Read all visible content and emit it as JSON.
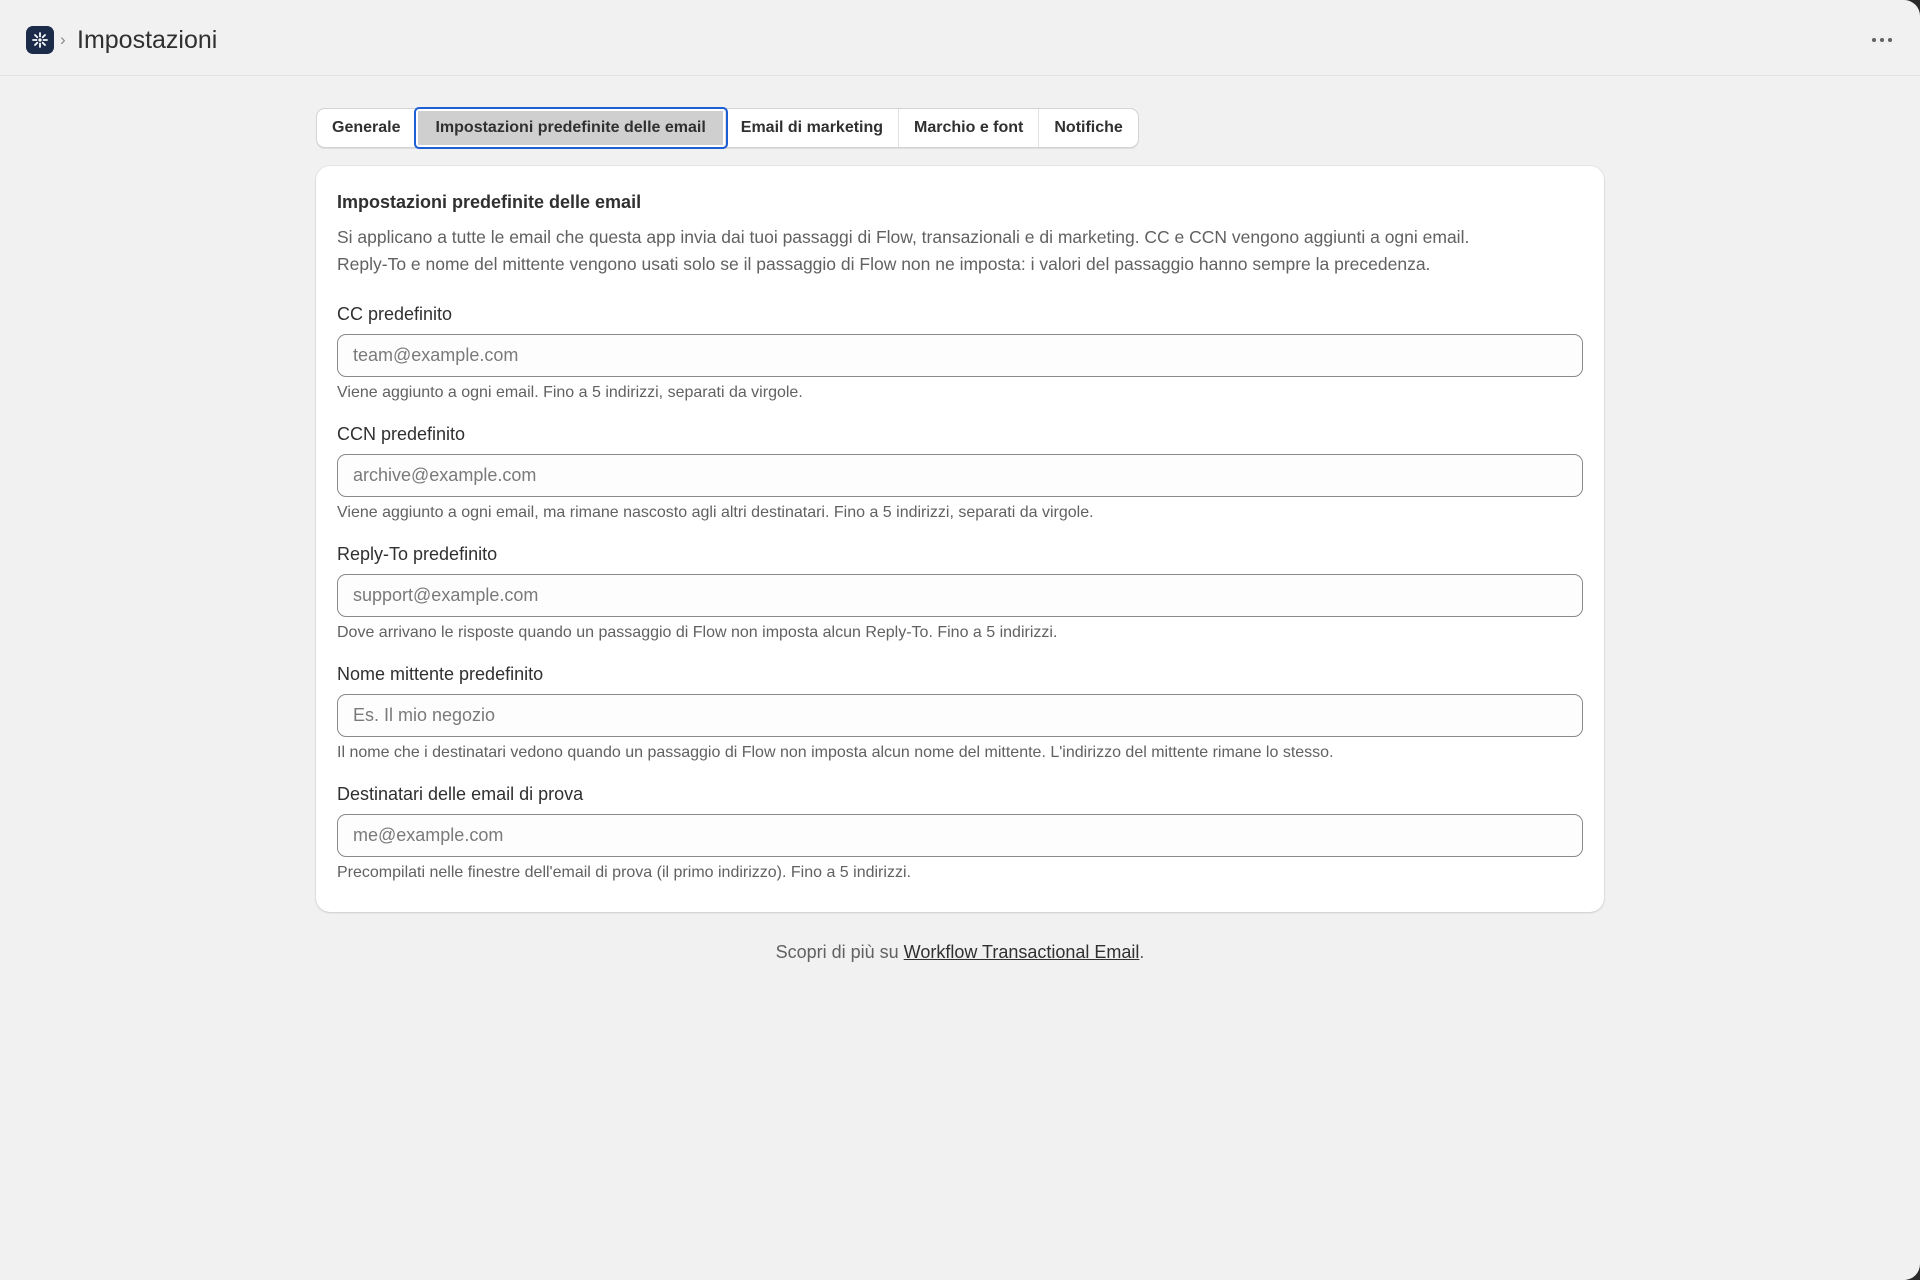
{
  "header": {
    "breadcrumb_separator": "›",
    "title": "Impostazioni",
    "more_label": "⋯"
  },
  "tabs": [
    {
      "label": "Generale",
      "active": false
    },
    {
      "label": "Impostazioni predefinite delle email",
      "active": true
    },
    {
      "label": "Email di marketing",
      "active": false
    },
    {
      "label": "Marchio e font",
      "active": false
    },
    {
      "label": "Notifiche",
      "active": false
    }
  ],
  "card": {
    "title": "Impostazioni predefinite delle email",
    "description_line1": "Si applicano a tutte le email che questa app invia dai tuoi passaggi di Flow, transazionali e di marketing. CC e CCN vengono aggiunti a ogni email.",
    "description_line2": "Reply-To e nome del mittente vengono usati solo se il passaggio di Flow non ne imposta: i valori del passaggio hanno sempre la precedenza.",
    "fields": [
      {
        "label": "CC predefinito",
        "value": "",
        "placeholder": "team@example.com",
        "help": "Viene aggiunto a ogni email. Fino a 5 indirizzi, separati da virgole."
      },
      {
        "label": "CCN predefinito",
        "value": "",
        "placeholder": "archive@example.com",
        "help": "Viene aggiunto a ogni email, ma rimane nascosto agli altri destinatari. Fino a 5 indirizzi, separati da virgole."
      },
      {
        "label": "Reply-To predefinito",
        "value": "",
        "placeholder": "support@example.com",
        "help": "Dove arrivano le risposte quando un passaggio di Flow non imposta alcun Reply-To. Fino a 5 indirizzi."
      },
      {
        "label": "Nome mittente predefinito",
        "value": "",
        "placeholder": "Es. Il mio negozio",
        "help": "Il nome che i destinatari vedono quando un passaggio di Flow non imposta alcun nome del mittente. L'indirizzo del mittente rimane lo stesso."
      },
      {
        "label": "Destinatari delle email di prova",
        "value": "",
        "placeholder": "me@example.com",
        "help": "Precompilati nelle finestre dell'email di prova (il primo indirizzo). Fino a 5 indirizzi."
      }
    ]
  },
  "footer": {
    "prefix": "Scopri di più su ",
    "link_text": "Workflow Transactional Email",
    "suffix": "."
  },
  "colors": {
    "background": "#f1f1f1",
    "logo": "#1c2b4a",
    "active_tab_outline": "#1f5fd6",
    "active_tab_fill": "#cfcfcf"
  },
  "icons": {
    "app_logo": "app-logo-icon",
    "more": "more-horizontal-icon"
  }
}
